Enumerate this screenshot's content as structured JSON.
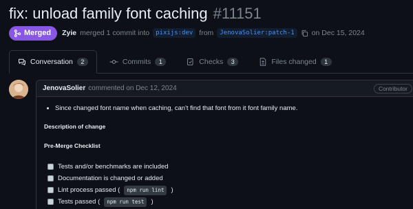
{
  "pr": {
    "title": "fix: unload family font caching",
    "number": "#11151",
    "status": "Merged",
    "author": "Zyie",
    "merge_text_1": "merged 1 commit into",
    "base_branch": "pixijs:dev",
    "from_text": "from",
    "head_branch": "JenovaSolier:patch-1",
    "merged_date": "on Dec 15, 2024"
  },
  "tabs": [
    {
      "label": "Conversation",
      "count": "2",
      "icon": "comment-discussion-icon",
      "active": true
    },
    {
      "label": "Commits",
      "count": "1",
      "icon": "git-commit-icon",
      "active": false
    },
    {
      "label": "Checks",
      "count": "3",
      "icon": "checklist-icon",
      "active": false
    },
    {
      "label": "Files changed",
      "count": "1",
      "icon": "file-diff-icon",
      "active": false
    }
  ],
  "comment": {
    "author": "JenovaSolier",
    "action": "commented on Dec 12, 2024",
    "role": "Contributor",
    "bullet": "Since changed font name when caching, can't find that font from it font family name.",
    "description_heading": "Description of change",
    "checklist_heading": "Pre-Merge Checklist",
    "tasks": [
      {
        "text": "Tests and/or benchmarks are included",
        "code": "",
        "suffix": ""
      },
      {
        "text": "Documentation is changed or added",
        "code": "",
        "suffix": ""
      },
      {
        "text": "Lint process passed (",
        "code": "npm run lint",
        "suffix": ")"
      },
      {
        "text": "Tests passed (",
        "code": "npm run test",
        "suffix": ")"
      }
    ]
  },
  "colors": {
    "background": "#0d1117",
    "merged_purple": "#8957e5",
    "link_blue": "#4493f8",
    "border": "#30363d"
  }
}
